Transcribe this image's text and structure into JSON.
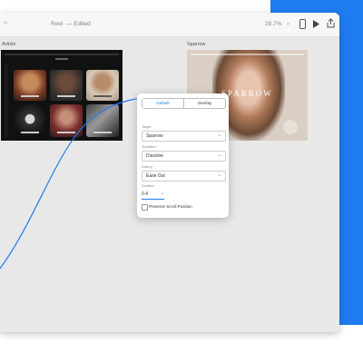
{
  "toolbar": {
    "title": "Reel",
    "status": "— Edited",
    "zoom": "28.7%",
    "icons": [
      "phone-preview-icon",
      "play-icon",
      "share-icon"
    ]
  },
  "canvas": {
    "artists_label": "Artists",
    "sparrow_label": "Sparrow",
    "sparrow_brand": "SPARROW"
  },
  "popover": {
    "tabs": [
      "Default",
      "Overlay"
    ],
    "active_tab": "Default",
    "target_label": "Target",
    "target_value": "Sparrow",
    "transition_label": "Transition",
    "transition_value": "Dissolve",
    "easing_label": "Easing",
    "easing_value": "Ease Out",
    "duration_label": "Duration",
    "duration_value": "0.4",
    "preserve_label": "Preserve Scroll Position"
  },
  "colors": {
    "accent": "#1f7cf0",
    "canvas_bg": "#e8e8e8"
  }
}
